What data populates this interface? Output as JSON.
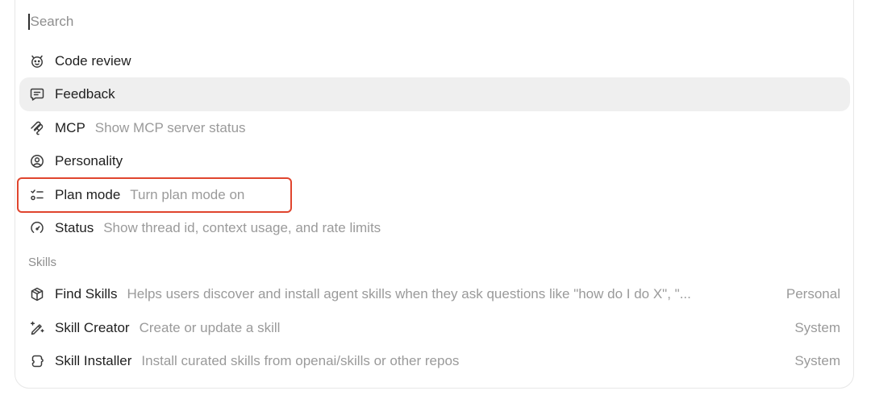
{
  "search": {
    "placeholder": "Search",
    "value": ""
  },
  "commands": [
    {
      "name": "Code review",
      "description": "",
      "icon": "code-review-icon"
    },
    {
      "name": "Feedback",
      "description": "",
      "icon": "feedback-icon",
      "highlighted": true
    },
    {
      "name": "MCP",
      "description": "Show MCP server status",
      "icon": "mcp-icon"
    },
    {
      "name": "Personality",
      "description": "",
      "icon": "personality-icon"
    },
    {
      "name": "Plan mode",
      "description": "Turn plan mode on",
      "icon": "plan-mode-icon"
    },
    {
      "name": "Status",
      "description": "Show thread id, context usage, and rate limits",
      "icon": "status-icon"
    }
  ],
  "skills_section": {
    "label": "Skills",
    "items": [
      {
        "name": "Find Skills",
        "description": "Helps users discover and install agent skills when they ask questions like \"how do I do X\", \"...",
        "badge": "Personal",
        "icon": "find-skills-icon"
      },
      {
        "name": "Skill Creator",
        "description": "Create or update a skill",
        "badge": "System",
        "icon": "skill-creator-icon"
      },
      {
        "name": "Skill Installer",
        "description": "Install curated skills from openai/skills or other repos",
        "badge": "System",
        "icon": "skill-installer-icon"
      }
    ]
  },
  "colors": {
    "annotation_box": "#e0452e",
    "highlight_row": "#efefef"
  }
}
